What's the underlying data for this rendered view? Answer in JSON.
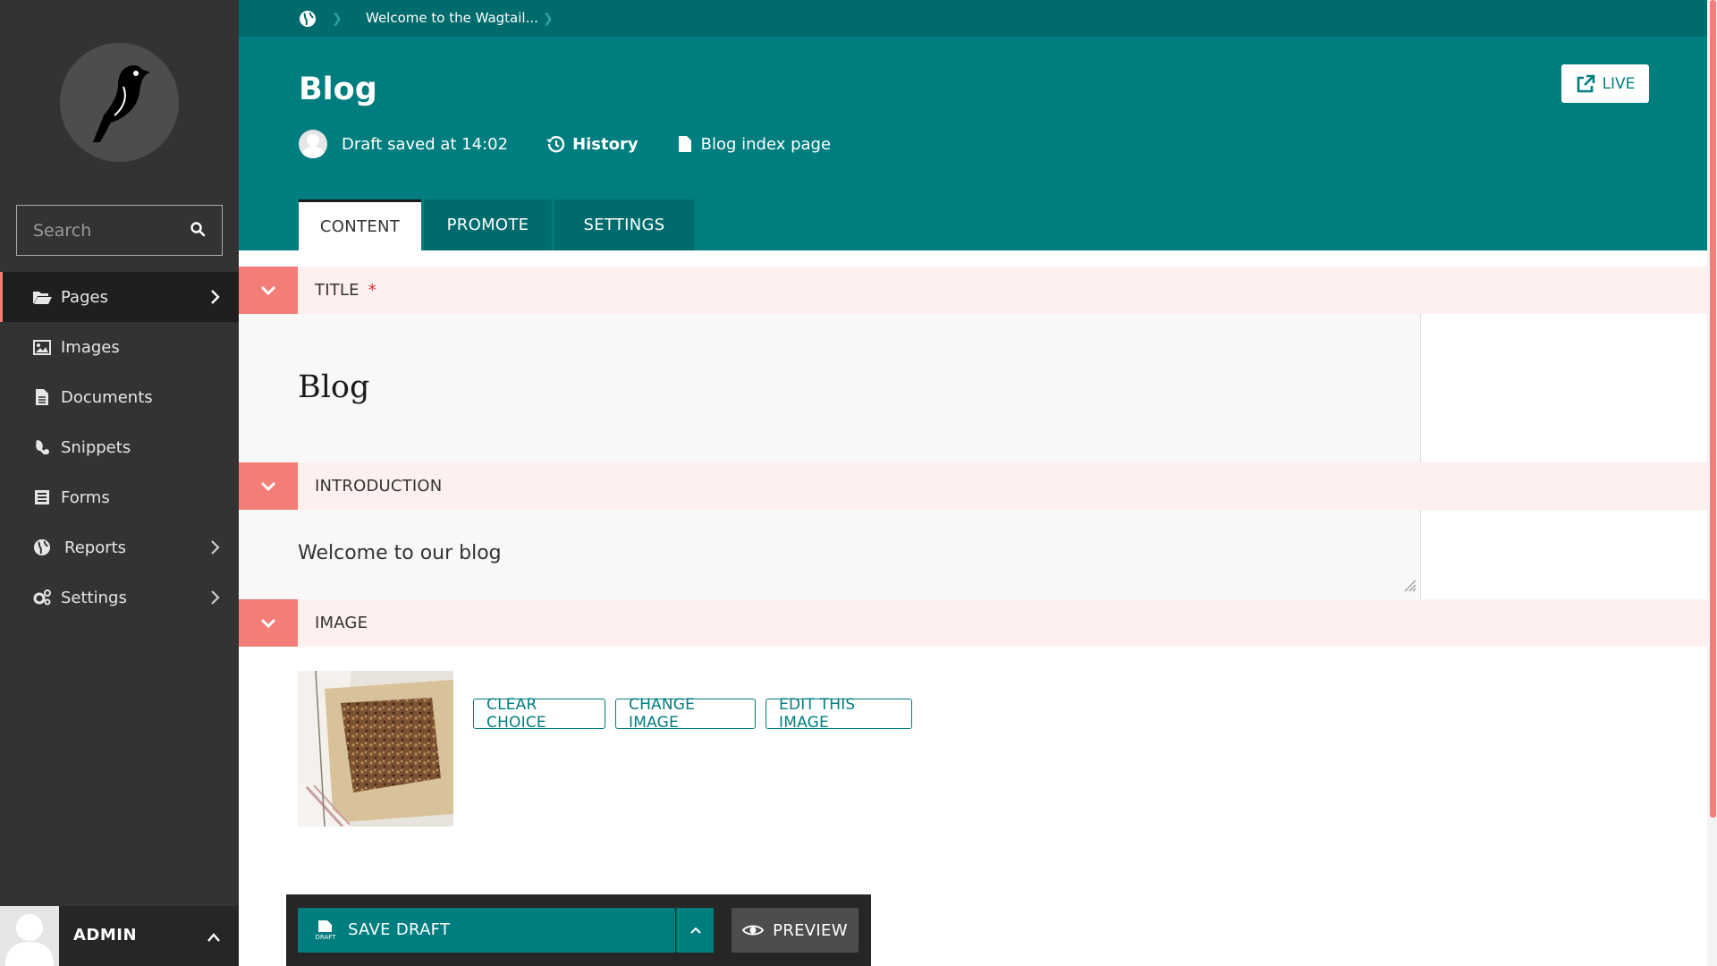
{
  "sidebar": {
    "search_placeholder": "Search",
    "items": [
      {
        "label": "Pages",
        "icon": "folder-open-icon",
        "active": true,
        "has_submenu": true
      },
      {
        "label": "Images",
        "icon": "image-icon",
        "active": false,
        "has_submenu": false
      },
      {
        "label": "Documents",
        "icon": "document-icon",
        "active": false,
        "has_submenu": false
      },
      {
        "label": "Snippets",
        "icon": "snippet-icon",
        "active": false,
        "has_submenu": false
      },
      {
        "label": "Forms",
        "icon": "form-icon",
        "active": false,
        "has_submenu": false
      },
      {
        "label": "Reports",
        "icon": "globe-icon",
        "active": false,
        "has_submenu": true
      },
      {
        "label": "Settings",
        "icon": "cogs-icon",
        "active": false,
        "has_submenu": true
      }
    ],
    "account": {
      "name": "ADMIN"
    }
  },
  "header": {
    "breadcrumb": "Welcome to the Wagtail...",
    "title": "Blog",
    "status": "Draft saved at 14:02",
    "history_label": "History",
    "page_type": "Blog index page",
    "live_label": "LIVE"
  },
  "tabs": [
    {
      "label": "CONTENT",
      "active": true
    },
    {
      "label": "PROMOTE",
      "active": false
    },
    {
      "label": "SETTINGS",
      "active": false
    }
  ],
  "form": {
    "title": {
      "label": "TITLE",
      "required_mark": "*",
      "value": "Blog"
    },
    "introduction": {
      "label": "INTRODUCTION",
      "value": "Welcome to our blog"
    },
    "image": {
      "label": "IMAGE",
      "buttons": {
        "clear": "CLEAR CHOICE",
        "change": "CHANGE IMAGE",
        "edit": "EDIT THIS IMAGE"
      }
    }
  },
  "footer": {
    "save_label": "SAVE DRAFT",
    "draft_badge": "DRAFT",
    "preview_label": "PREVIEW"
  },
  "colors": {
    "teal": "#007d7e",
    "teal_dark": "#006b6c",
    "sidebar": "#333333",
    "salmon": "#f37e77",
    "section_bg": "#fdf0ef"
  }
}
